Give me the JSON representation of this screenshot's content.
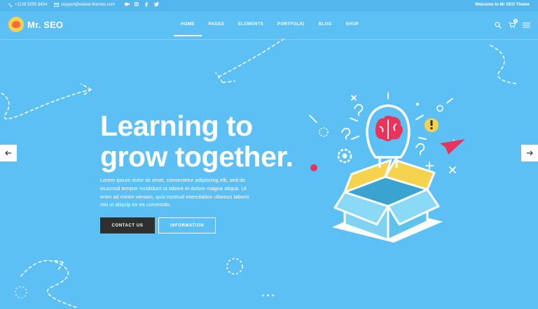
{
  "topbar": {
    "phone": "+1128 5255 8454",
    "email": "support@elated-themes.com",
    "welcome": "Welcome to Mr SEO Theme",
    "social_icons": [
      "video-icon",
      "instagram-icon",
      "facebook-icon",
      "twitter-icon"
    ]
  },
  "brand": {
    "name": "Mr. SEO"
  },
  "nav": {
    "items": [
      {
        "label": "HOME",
        "active": true
      },
      {
        "label": "PAGES",
        "active": false
      },
      {
        "label": "ELEMENTS",
        "active": false
      },
      {
        "label": "PORTFOLIO",
        "active": false
      },
      {
        "label": "BLOG",
        "active": false
      },
      {
        "label": "SHOP",
        "active": false
      }
    ],
    "cart_count": "0",
    "icons": [
      "search-icon",
      "cart-icon",
      "hamburger-icon"
    ]
  },
  "hero": {
    "title_line1": "Learning to",
    "title_line2": "grow together.",
    "text": "Lorem ipsum dolor sit amet, consectetur adipiscing elit, sed do eiusmod tempor incididunt ut labore et dolore magna aliqua. Ut enim ad minim veniam, quis nostrud exercitation ullamco laboris nisi ut aliquip ex ea commodo.",
    "cta_primary": "CONTACT US",
    "cta_secondary": "INFORMATION"
  },
  "slider": {
    "dots": 3,
    "active_dot": 1
  },
  "colors": {
    "background": "#5cc0f5",
    "primary_button": "#2f2f2f",
    "accent_pink": "#e8345a",
    "accent_yellow": "#f6d34e",
    "box_blue": "#7fd2f2"
  }
}
